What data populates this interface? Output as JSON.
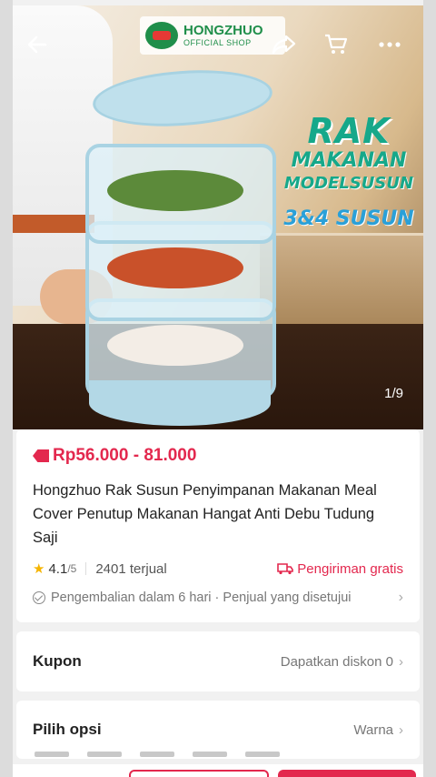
{
  "header": {
    "logo_name": "HONGZHUO",
    "logo_sub": "OFFICIAL SHOP",
    "back_icon": "arrow-left-icon",
    "share_icon": "share-icon",
    "cart_icon": "cart-icon",
    "more_icon": "more-dots-icon"
  },
  "hero": {
    "promo_line1": "RAK",
    "promo_line2": "MAKANAN",
    "promo_line3": "MODELSUSUN",
    "promo_line4": "3&4 SUSUN",
    "image_counter": "1/9"
  },
  "product": {
    "price": "Rp56.000 - 81.000",
    "title": "Hongzhuo Rak Susun Penyimpanan Makanan Meal Cover Penutup Makanan Hangat Anti Debu Tudung Saji",
    "rating": "4.1",
    "rating_max": "/5",
    "sold": "2401 terjual",
    "shipping": "Pengiriman gratis",
    "returns": "Pengembalian dalam 6 hari · Penjual yang disetujui"
  },
  "coupon": {
    "label": "Kupon",
    "value": "Dapatkan diskon 0"
  },
  "options": {
    "label": "Pilih opsi",
    "value": "Warna"
  },
  "colors": {
    "accent": "#e3284e",
    "brand_green": "#1f8e4a",
    "rack_blue": "#a9d3e3"
  }
}
